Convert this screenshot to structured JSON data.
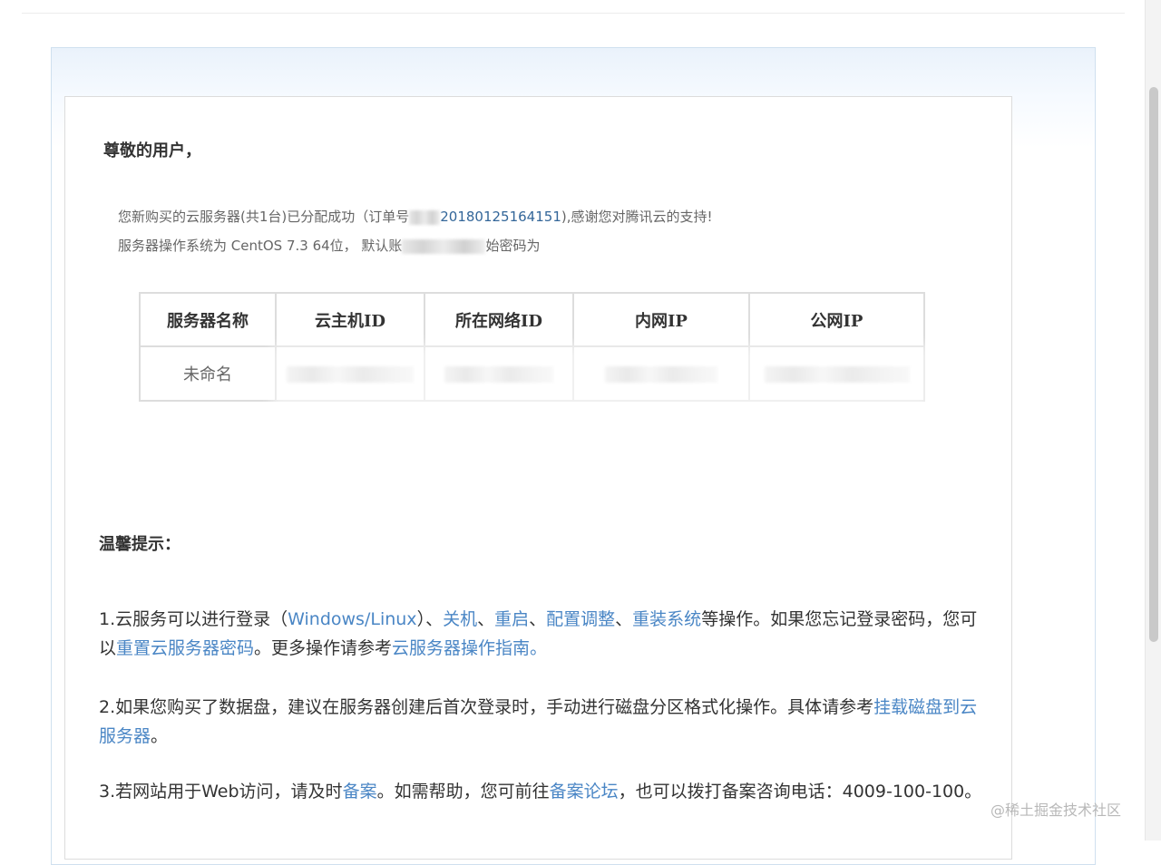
{
  "greeting": "尊敬的用户，",
  "intro": {
    "line1_prefix": "您新购买的云服务器(共1台)已分配成功（订单号",
    "order_number": "20180125164151",
    "line1_suffix": "),感谢您对腾讯云的支持!",
    "line2_prefix": "服务器操作系统为 CentOS 7.3 64位， 默认账",
    "line2_suffix": "始密码为"
  },
  "server_table": {
    "headers": [
      "服务器名称",
      "云主机ID",
      "所在网络ID",
      "内网IP",
      "公网IP"
    ],
    "rows": [
      {
        "name": "未命名"
      }
    ]
  },
  "tips": {
    "title": "温馨提示：",
    "tip1": {
      "prefix": "1.云服务可以进行登录（",
      "login_link": "Windows/Linux",
      "sep1": "）、",
      "shutdown_link": "关机",
      "sep2": "、",
      "restart_link": "重启",
      "sep3": "、",
      "config_link": "配置调整",
      "sep4": "、",
      "reinstall_link": "重装系统",
      "mid": "等操作。如果您忘记登录密码，您可以",
      "reset_link": "重置云服务器密码",
      "mid2": "。更多操作请参考",
      "guide_link": "云服务器操作指南",
      "end": "。"
    },
    "tip2": {
      "text": "2.如果您购买了数据盘，建议在服务器创建后首次登录时，手动进行磁盘分区格式化操作。具体请参考",
      "mount_link": "挂载磁盘到云服务器",
      "end": "。"
    },
    "tip3": {
      "prefix": "3.若网站用于Web访问，请及时",
      "filing_link": "备案",
      "mid": "。如需帮助，您可前往",
      "forum_link": "备案论坛",
      "end": "，也可以拨打备案咨询电话：4009-100-100。"
    }
  },
  "watermark": "@稀土掘金技术社区",
  "colors": {
    "link": "#4a86c5",
    "order_number": "#336699",
    "text": "#333333",
    "muted": "#666666",
    "border": "#dddddd"
  }
}
